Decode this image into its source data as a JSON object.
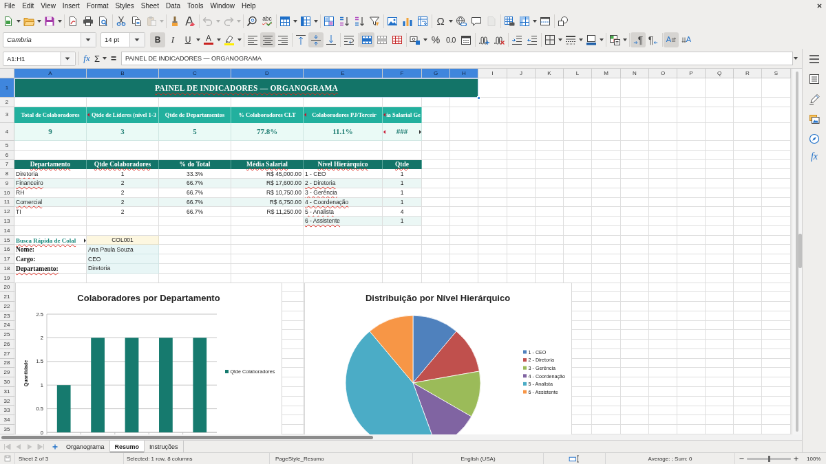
{
  "menu_bar": {
    "items": [
      "File",
      "Edit",
      "View",
      "Insert",
      "Format",
      "Styles",
      "Sheet",
      "Data",
      "Tools",
      "Window",
      "Help"
    ]
  },
  "standard_toolbar": {
    "paste_disabled": true,
    "undo_disabled": true,
    "redo_disabled": true,
    "header_footer_disabled": true,
    "spelling_label": "abc",
    "special_character_label": "Ω"
  },
  "formatting_toolbar": {
    "font_name": "Cambria",
    "font_size": "14 pt",
    "style_buttons": [
      {
        "label": "B",
        "on": true
      },
      {
        "label": "I",
        "on": false
      },
      {
        "label": "U",
        "on": false
      }
    ],
    "font_color_label": "A",
    "horizontal_align_buttons": [
      {
        "selected": false
      },
      {
        "selected": true
      },
      {
        "selected": false
      }
    ],
    "vertical_align_buttons": [
      {
        "selected": false
      },
      {
        "selected": true
      },
      {
        "selected": false
      }
    ],
    "merge_buttons": [
      {
        "selected": true
      },
      {
        "selected": false
      },
      {
        "selected": false
      }
    ],
    "percent_label": "%",
    "decimal_label": "0.0",
    "direction_buttons": [
      {
        "label": "¶",
        "selected": true
      },
      {
        "label": "¶",
        "selected": false
      }
    ],
    "orientation_buttons": [
      {
        "label": "A",
        "selected": true
      },
      {
        "label": "A",
        "selected": false
      }
    ]
  },
  "formula_bar": {
    "name_box": "A1:H1",
    "function_wizard_label": "fx",
    "sum_label": "Σ",
    "equals_label": "=",
    "content": "PAINEL DE INDICADORES — ORGANOGRAMA"
  },
  "sidebar": {
    "functions_label": "fx"
  },
  "sheet": {
    "column_headers": [
      {
        "label": "A",
        "selected": true
      },
      {
        "label": "B",
        "selected": true
      },
      {
        "label": "C",
        "selected": true
      },
      {
        "label": "D",
        "selected": true
      },
      {
        "label": "E",
        "selected": true
      },
      {
        "label": "F",
        "selected": true
      },
      {
        "label": "G",
        "selected": true
      },
      {
        "label": "H",
        "selected": true
      },
      {
        "label": "I",
        "selected": false
      },
      {
        "label": "J",
        "selected": false
      },
      {
        "label": "K",
        "selected": false
      },
      {
        "label": "L",
        "selected": false
      },
      {
        "label": "M",
        "selected": false
      },
      {
        "label": "N",
        "selected": false
      },
      {
        "label": "O",
        "selected": false
      },
      {
        "label": "P",
        "selected": false
      },
      {
        "label": "Q",
        "selected": false
      },
      {
        "label": "R",
        "selected": false
      },
      {
        "label": "S",
        "selected": false
      }
    ],
    "row_headers": [
      {
        "label": "1",
        "selected": true
      },
      {
        "label": "2",
        "selected": false
      },
      {
        "label": "3",
        "selected": false
      },
      {
        "label": "4",
        "selected": false
      },
      {
        "label": "5",
        "selected": false
      },
      {
        "label": "6",
        "selected": false
      },
      {
        "label": "7",
        "selected": false
      },
      {
        "label": "8",
        "selected": false
      },
      {
        "label": "9",
        "selected": false
      },
      {
        "label": "10",
        "selected": false
      },
      {
        "label": "11",
        "selected": false
      },
      {
        "label": "12",
        "selected": false
      },
      {
        "label": "13",
        "selected": false
      },
      {
        "label": "14",
        "selected": false
      },
      {
        "label": "15",
        "selected": false
      },
      {
        "label": "16",
        "selected": false
      },
      {
        "label": "17",
        "selected": false
      },
      {
        "label": "18",
        "selected": false
      },
      {
        "label": "19",
        "selected": false
      },
      {
        "label": "20",
        "selected": false
      },
      {
        "label": "21",
        "selected": false
      },
      {
        "label": "22",
        "selected": false
      },
      {
        "label": "23",
        "selected": false
      },
      {
        "label": "24",
        "selected": false
      },
      {
        "label": "25",
        "selected": false
      },
      {
        "label": "26",
        "selected": false
      },
      {
        "label": "27",
        "selected": false
      },
      {
        "label": "28",
        "selected": false
      },
      {
        "label": "29",
        "selected": false
      },
      {
        "label": "30",
        "selected": false
      },
      {
        "label": "31",
        "selected": false
      },
      {
        "label": "32",
        "selected": false
      },
      {
        "label": "33",
        "selected": false
      },
      {
        "label": "34",
        "selected": false
      },
      {
        "label": "35",
        "selected": false
      }
    ],
    "title": {
      "text": "PAINEL DE INDICADORES — ORGANOGRAMA",
      "selected": true,
      "spellcheck_flag": true
    },
    "kpis": [
      {
        "label": "Total de Colaboradores",
        "value": "9",
        "label_clipped": false,
        "value_clipped": false
      },
      {
        "label": "Qtde de Líderes (nível 1-3",
        "value": "3",
        "label_clipped": true,
        "value_clipped": false
      },
      {
        "label": "Qtde de Departamentos",
        "value": "5",
        "label_clipped": false,
        "value_clipped": false
      },
      {
        "label": "% Colaboradores CLT",
        "value": "77.8%",
        "label_clipped": false,
        "value_clipped": false
      },
      {
        "label": "Colaboradores PJ/Terceir",
        "value": "11.1%",
        "label_clipped": true,
        "value_clipped": false
      },
      {
        "label": "ia Salarial Ge",
        "value": "###",
        "label_clipped": true,
        "value_clipped": true
      }
    ],
    "department_table": {
      "columns": [
        {
          "text": "Departamento",
          "spellcheck_flag": true
        },
        {
          "text": "Qtde Colaboradores",
          "spellcheck_flag": true
        },
        {
          "text": "% do Total",
          "spellcheck_flag": false
        },
        {
          "text": "Média Salarial",
          "spellcheck_flag": true
        }
      ],
      "rows": [
        {
          "cells": [
            "Diretoria",
            "1",
            "33.3%",
            "R$ 45,000.00"
          ],
          "spellcheck_flag": true
        },
        {
          "cells": [
            "Financeiro",
            "2",
            "66.7%",
            "R$ 17,600.00"
          ],
          "spellcheck_flag": true
        },
        {
          "cells": [
            "RH",
            "2",
            "66.7%",
            "R$ 10,750.00"
          ],
          "spellcheck_flag": false
        },
        {
          "cells": [
            "Comercial",
            "2",
            "66.7%",
            "R$ 6,750.00"
          ],
          "spellcheck_flag": true
        },
        {
          "cells": [
            "TI",
            "2",
            "66.7%",
            "R$ 11,250.00"
          ],
          "spellcheck_flag": false
        }
      ]
    },
    "level_table": {
      "columns": [
        {
          "text": "Nível Hierárquico",
          "spellcheck_flag": true
        },
        {
          "text": "Qtde",
          "spellcheck_flag": true
        }
      ],
      "rows": [
        {
          "cells": [
            "1 - CEO",
            "1"
          ],
          "spellcheck_flag": false
        },
        {
          "cells": [
            "2 - Diretoria",
            "1"
          ],
          "spellcheck_flag": true
        },
        {
          "cells": [
            "3 - Gerência",
            "1"
          ],
          "spellcheck_flag": true
        },
        {
          "cells": [
            "4 - Coordenação",
            "1"
          ],
          "spellcheck_flag": true
        },
        {
          "cells": [
            "5 - Analista",
            "4"
          ],
          "spellcheck_flag": true
        },
        {
          "cells": [
            "6 - Assistente",
            "1"
          ],
          "spellcheck_flag": true
        }
      ]
    },
    "lookup": {
      "label": "Busca Rápida de Colal",
      "label_clipped": true,
      "spellcheck_flag": true,
      "code": "COL001",
      "fields": [
        {
          "label": "Nome:",
          "value": "Ana Paula Souza",
          "spellcheck_flag": false
        },
        {
          "label": "Cargo:",
          "value": "CEO",
          "spellcheck_flag": false
        },
        {
          "label": "Departamento:",
          "value": "Diretoria",
          "spellcheck_flag": true
        }
      ]
    },
    "charts": [
      {
        "chart_data": {
          "type": "bar",
          "title": "Colaboradores por Departamento",
          "ylabel": "Quantidade",
          "series": [
            {
              "name": "Qtde Colaboradores",
              "color": "#167a6e",
              "values": [
                1,
                2,
                2,
                2,
                2
              ]
            }
          ],
          "ylim": [
            0,
            2.5
          ],
          "yticks": [
            {
              "value": 0,
              "label": "0"
            },
            {
              "value": 0.5,
              "label": "0.5"
            },
            {
              "value": 1,
              "label": "1"
            },
            {
              "value": 1.5,
              "label": "1.5"
            },
            {
              "value": 2,
              "label": "2"
            },
            {
              "value": 2.5,
              "label": "2.5"
            }
          ],
          "grid": true,
          "legend": true
        }
      },
      {
        "chart_data": {
          "type": "pie",
          "title": "Distribuição por Nível Hierárquico",
          "categories": [
            "1 - CEO",
            "2 - Diretoria",
            "3 - Gerência",
            "4 - Coordenação",
            "5 - Analista",
            "6 - Assistente"
          ],
          "values": [
            1,
            1,
            1,
            1,
            4,
            1
          ],
          "colors": [
            "#4f81bd",
            "#c0504d",
            "#9bbb59",
            "#8064a2",
            "#4bacc6",
            "#f79646"
          ],
          "legend": true
        }
      }
    ]
  },
  "sheet_navigation": {
    "disabled": true
  },
  "sheet_tabs": [
    {
      "label": "Organograma",
      "selected": false
    },
    {
      "label": "Resumo",
      "selected": true
    },
    {
      "label": "Instruções",
      "selected": false
    }
  ],
  "status_bar": {
    "sheet_info": "Sheet 2 of 3",
    "selection": "Selected: 1 row, 8 columns",
    "page_style": "PageStyle_Resumo",
    "language": "English (USA)",
    "formula": "Average: ; Sum: 0",
    "zoom": {
      "level": 0.5,
      "label": "100%"
    }
  }
}
